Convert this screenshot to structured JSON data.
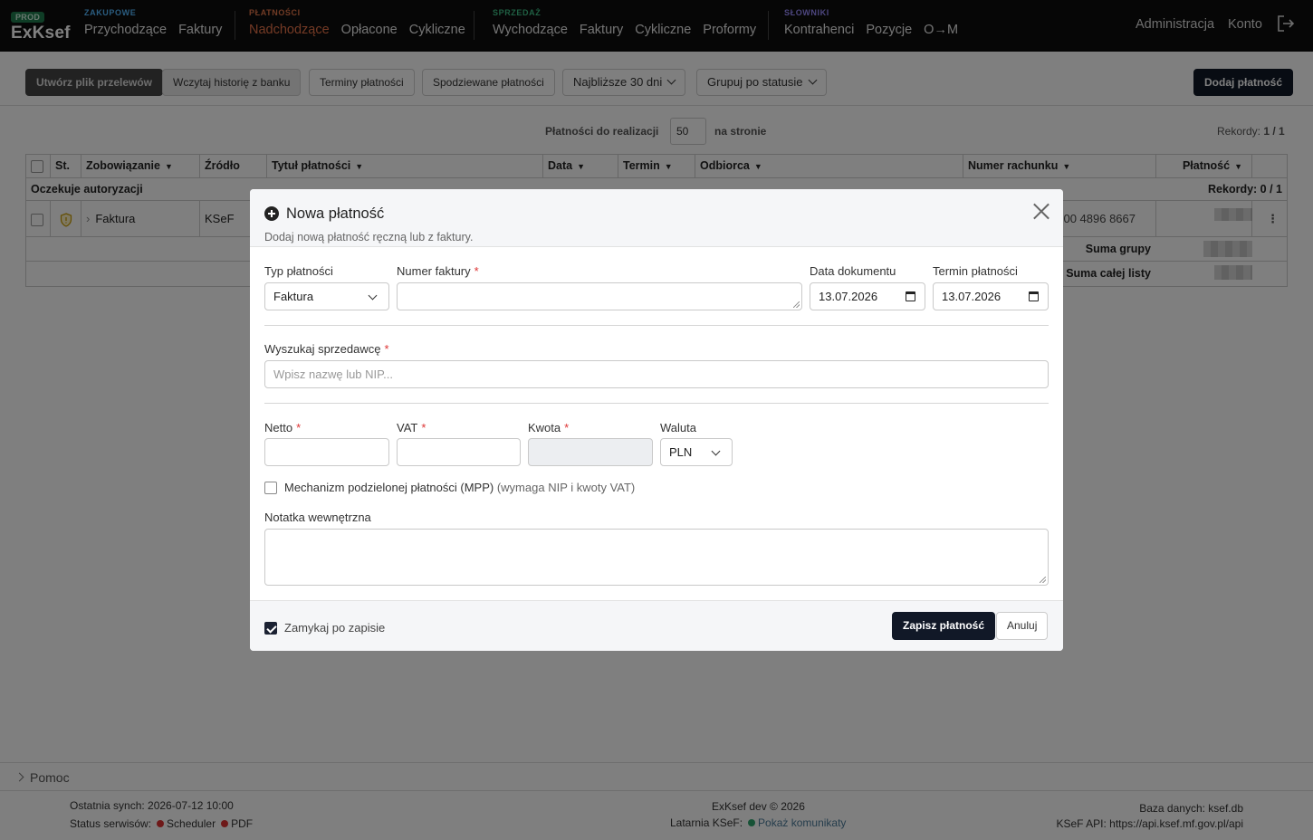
{
  "app": {
    "env_badge": "PROD",
    "logo": "ExKsef"
  },
  "nav": {
    "groups": [
      {
        "label": "ZAKUPOWE",
        "links": [
          "Przychodzące",
          "Faktury"
        ]
      },
      {
        "label": "PŁATNOŚCI",
        "links": [
          "Nadchodzące",
          "Opłacone",
          "Cykliczne"
        ],
        "active_index": 0
      },
      {
        "label": "SPRZEDAŻ",
        "links": [
          "Wychodzące",
          "Faktury",
          "Cykliczne",
          "Proformy"
        ]
      },
      {
        "label": "SŁOWNIKI",
        "links": [
          "Kontrahenci",
          "Pozycje",
          "O→M"
        ]
      }
    ],
    "admin": "Administracja",
    "account": "Konto",
    "logout_icon": "logout-icon"
  },
  "toolbar": {
    "create_transfers": "Utwórz plik przelewów",
    "load_history": "Wczytaj historię z banku",
    "payment_terms": "Terminy płatności",
    "expected_payments": "Spodziewane płatności",
    "range_select": "Najbliższe 30 dni",
    "group_select": "Grupuj po statusie",
    "add_payment": "Dodaj płatność"
  },
  "pagination": {
    "label_before": "Płatności do realizacji",
    "page_size": "50",
    "label_after": "na stronie",
    "records_label": "Rekordy:",
    "records_value": "1 / 1"
  },
  "table": {
    "columns": [
      "St.",
      "Zobowiązanie",
      "Źródło",
      "Tytuł płatności",
      "Data",
      "Termin",
      "Odbiorca",
      "Numer rachunku",
      "Płatność"
    ],
    "group": {
      "label": "Oczekuje autoryzacji",
      "records": "Rekordy: 0 / 1"
    },
    "row": {
      "type": "Faktura",
      "source": "KSeF",
      "account_tail": "0000 4896 8667"
    },
    "sum_group": "Suma grupy",
    "sum_list": "Suma całej listy"
  },
  "modal": {
    "title": "Nowa płatność",
    "subtitle": "Dodaj nową płatność ręczną lub z faktury.",
    "payment_type_label": "Typ płatności",
    "payment_type_value": "Faktura",
    "invoice_number_label": "Numer faktury",
    "invoice_number_value": "",
    "doc_date_label": "Data dokumentu",
    "doc_date_value": "13.07.2026",
    "due_date_label": "Termin płatności",
    "due_date_value": "13.07.2026",
    "seller_label": "Wyszukaj sprzedawcę",
    "seller_placeholder": "Wpisz nazwę lub NIP...",
    "net_label": "Netto",
    "vat_label": "VAT",
    "amount_label": "Kwota",
    "currency_label": "Waluta",
    "currency_value": "PLN",
    "mpp_label": "Mechanizm podzielonej płatności (MPP)",
    "mpp_hint": "(wymaga NIP i kwoty VAT)",
    "mpp_checked": false,
    "note_label": "Notatka wewnętrzna",
    "close_after_save": "Zamykaj po zapisie",
    "close_after_save_checked": true,
    "save": "Zapisz płatność",
    "cancel": "Anuluj"
  },
  "help": {
    "label": "Pomoc"
  },
  "footer": {
    "last_sync": "Ostatnia synch: 2026-07-12 10:00",
    "services_label": "Status serwisów:",
    "service_scheduler": "Scheduler",
    "service_pdf": "PDF",
    "copyright": "ExKsef dev © 2026",
    "lighthouse_label": "Latarnia KSeF:",
    "lighthouse_link": "Pokaż komunikaty",
    "db": "Baza danych: ksef.db",
    "api": "KSeF API: https://api.ksef.mf.gov.pl/api"
  },
  "colors": {
    "accent_active": "#e8744a",
    "primary_button": "#111827",
    "status_red": "#dd3333",
    "status_green": "#2ea56d"
  }
}
